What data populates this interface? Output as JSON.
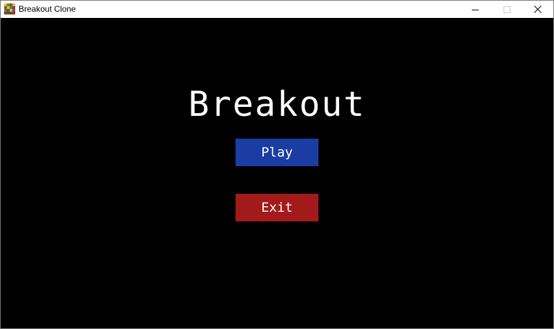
{
  "window": {
    "title": "Breakout Clone",
    "app_icon": "breakout-app-icon",
    "controls": {
      "minimize_icon": "minimize-icon",
      "maximize_icon": "maximize-icon",
      "close_icon": "close-icon"
    }
  },
  "game": {
    "title": "Breakout",
    "background_color": "#000000",
    "menu": [
      {
        "id": "play",
        "label": "Play",
        "color": "#1a3ca3"
      },
      {
        "id": "exit",
        "label": "Exit",
        "color": "#a31a1a"
      }
    ]
  },
  "colors": {
    "title_text": "#ffffff",
    "button_text": "#ffffff"
  }
}
